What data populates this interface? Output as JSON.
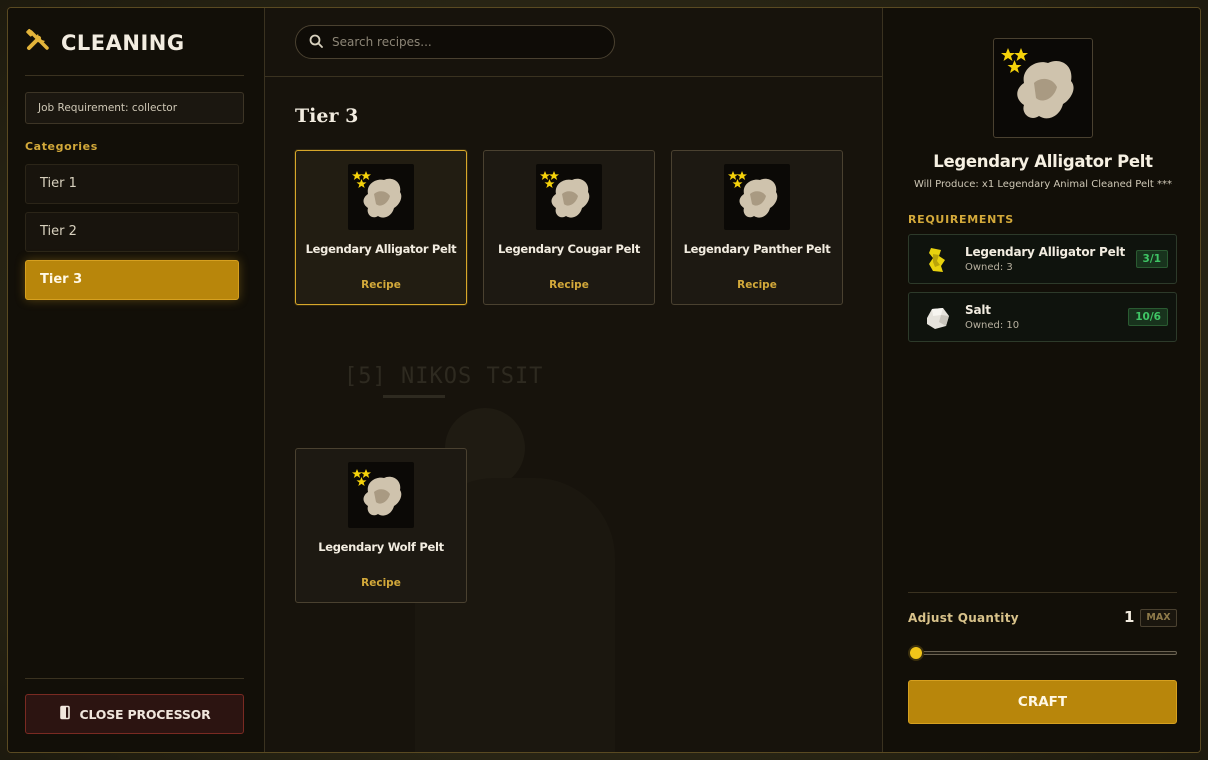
{
  "app": {
    "title": "CLEANING",
    "job_requirement": "Job Requirement: collector",
    "categories_heading": "Categories",
    "categories": [
      {
        "label": "Tier 1",
        "active": false
      },
      {
        "label": "Tier 2",
        "active": false
      },
      {
        "label": "Tier 3",
        "active": true
      }
    ],
    "close_label": "CLOSE PROCESSOR"
  },
  "search": {
    "placeholder": "Search recipes...",
    "value": ""
  },
  "main": {
    "tier_title": "Tier 3",
    "watermark": "[5] NIKOS TSIT",
    "recipes": [
      {
        "name": "Legendary Alligator Pelt",
        "kind": "Recipe",
        "stars": 3,
        "selected": true
      },
      {
        "name": "Legendary Cougar Pelt",
        "kind": "Recipe",
        "stars": 3,
        "selected": false
      },
      {
        "name": "Legendary Panther Pelt",
        "kind": "Recipe",
        "stars": 3,
        "selected": false
      },
      {
        "name": "Legendary Wolf Pelt",
        "kind": "Recipe",
        "stars": 3,
        "selected": false
      }
    ]
  },
  "detail": {
    "title": "Legendary Alligator Pelt",
    "produce": "Will Produce: x1 Legendary Animal Cleaned Pelt ***",
    "requirements_heading": "REQUIREMENTS",
    "requirements": [
      {
        "name": "Legendary Alligator Pelt",
        "owned": "Owned: 3",
        "badge": "3/1",
        "icon": "alligator-pelt-icon"
      },
      {
        "name": "Salt",
        "owned": "Owned: 10",
        "badge": "10/6",
        "icon": "salt-icon"
      }
    ],
    "quantity_label": "Adjust Quantity",
    "quantity": "1",
    "max_label": "MAX",
    "craft_label": "CRAFT"
  },
  "colors": {
    "accent": "#b8860b",
    "success": "#3fc565",
    "danger_bg": "#2c1411",
    "star": "#f5d20a"
  }
}
